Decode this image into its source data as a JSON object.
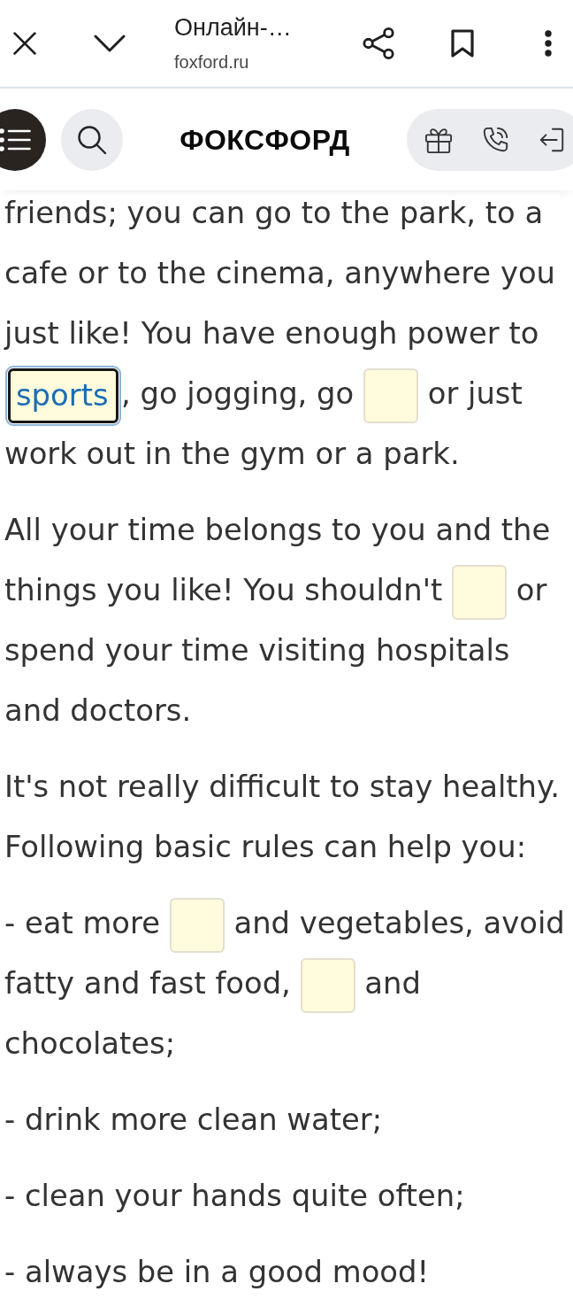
{
  "browser_bar": {
    "title": "Онлайн-…",
    "url": "foxford.ru"
  },
  "site_header": {
    "logo": "ФОКСФОРД"
  },
  "paragraphs": [
    {
      "segments": [
        {
          "kind": "text",
          "text": "friends; you can go to the park, to a cafe or to the cinema, anywhere you just like! You have enough power to "
        },
        {
          "kind": "blank",
          "value": "sports",
          "focused": true
        },
        {
          "kind": "text",
          "text": ", go jogging, go "
        },
        {
          "kind": "blank",
          "focused": false
        },
        {
          "kind": "text",
          "text": " or just work out in the gym or a park."
        }
      ]
    },
    {
      "segments": [
        {
          "kind": "text",
          "text": "All your time belongs to you and the things you like! You shouldn't "
        },
        {
          "kind": "blank",
          "focused": false
        },
        {
          "kind": "text",
          "text": " or spend your time visiting hospitals and doctors."
        }
      ]
    },
    {
      "segments": [
        {
          "kind": "text",
          "text": "It's not really difficult to stay healthy. Following basic rules can help you:"
        }
      ]
    },
    {
      "segments": [
        {
          "kind": "text",
          "text": "- eat more "
        },
        {
          "kind": "blank",
          "focused": false
        },
        {
          "kind": "text",
          "text": " and vegetables, avoid fatty and fast food, "
        },
        {
          "kind": "blank",
          "focused": false
        },
        {
          "kind": "text",
          "text": " and chocolates;"
        }
      ]
    },
    {
      "segments": [
        {
          "kind": "text",
          "text": "- drink more clean water;"
        }
      ]
    },
    {
      "segments": [
        {
          "kind": "text",
          "text": "- clean your hands quite often;"
        }
      ]
    },
    {
      "segments": [
        {
          "kind": "text",
          "text": "- always be in a good mood!"
        }
      ]
    }
  ]
}
